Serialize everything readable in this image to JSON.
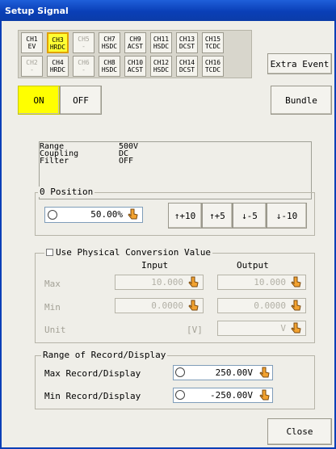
{
  "window": {
    "title": "Setup Signal"
  },
  "channels": [
    {
      "id": "CH1",
      "sub": "EV",
      "enabled": true,
      "selected": false
    },
    {
      "id": "CH3",
      "sub": "HRDC",
      "enabled": true,
      "selected": true
    },
    {
      "id": "CH5",
      "sub": "-",
      "enabled": false,
      "selected": false
    },
    {
      "id": "CH7",
      "sub": "HSDC",
      "enabled": true,
      "selected": false
    },
    {
      "id": "CH9",
      "sub": "ACST",
      "enabled": true,
      "selected": false
    },
    {
      "id": "CH11",
      "sub": "HSDC",
      "enabled": true,
      "selected": false
    },
    {
      "id": "CH13",
      "sub": "DCST",
      "enabled": true,
      "selected": false
    },
    {
      "id": "CH15",
      "sub": "TCDC",
      "enabled": true,
      "selected": false
    },
    {
      "id": "CH2",
      "sub": "-",
      "enabled": false,
      "selected": false
    },
    {
      "id": "CH4",
      "sub": "HRDC",
      "enabled": true,
      "selected": false
    },
    {
      "id": "CH6",
      "sub": "-",
      "enabled": false,
      "selected": false
    },
    {
      "id": "CH8",
      "sub": "HSDC",
      "enabled": true,
      "selected": false
    },
    {
      "id": "CH10",
      "sub": "ACST",
      "enabled": true,
      "selected": false
    },
    {
      "id": "CH12",
      "sub": "HSDC",
      "enabled": true,
      "selected": false
    },
    {
      "id": "CH14",
      "sub": "DCST",
      "enabled": true,
      "selected": false
    },
    {
      "id": "CH16",
      "sub": "TCDC",
      "enabled": true,
      "selected": false
    }
  ],
  "buttons": {
    "extra_event": "Extra Event",
    "on": "ON",
    "off": "OFF",
    "bundle": "Bundle",
    "close": "Close"
  },
  "summary": {
    "rows": [
      {
        "label": "Range",
        "value": "500V"
      },
      {
        "label": "Coupling",
        "value": "DC"
      },
      {
        "label": "Filter",
        "value": "OFF"
      }
    ]
  },
  "zero_position": {
    "label": "0 Position",
    "value": "50.00%",
    "steps": [
      "↑+10",
      "↑+5",
      "↓-5",
      "↓-10"
    ]
  },
  "physical": {
    "checkbox_label": "Use Physical Conversion Value",
    "checked": false,
    "input_header": "Input",
    "output_header": "Output",
    "max_label": "Max",
    "min_label": "Min",
    "unit_label": "Unit",
    "max_input": "10.000",
    "max_output": "10.000",
    "min_input": "0.0000",
    "min_output": "0.0000",
    "unit_input": "[V]",
    "unit_output": "V"
  },
  "range_display": {
    "label": "Range of Record/Display",
    "max_label": "Max Record/Display",
    "max_value": "250.00V",
    "min_label": "Min Record/Display",
    "min_value": "-250.00V"
  },
  "colors": {
    "titlebar": "#0a3fb7",
    "selected_channel": "#ffff33",
    "on_button": "#ffff00"
  }
}
